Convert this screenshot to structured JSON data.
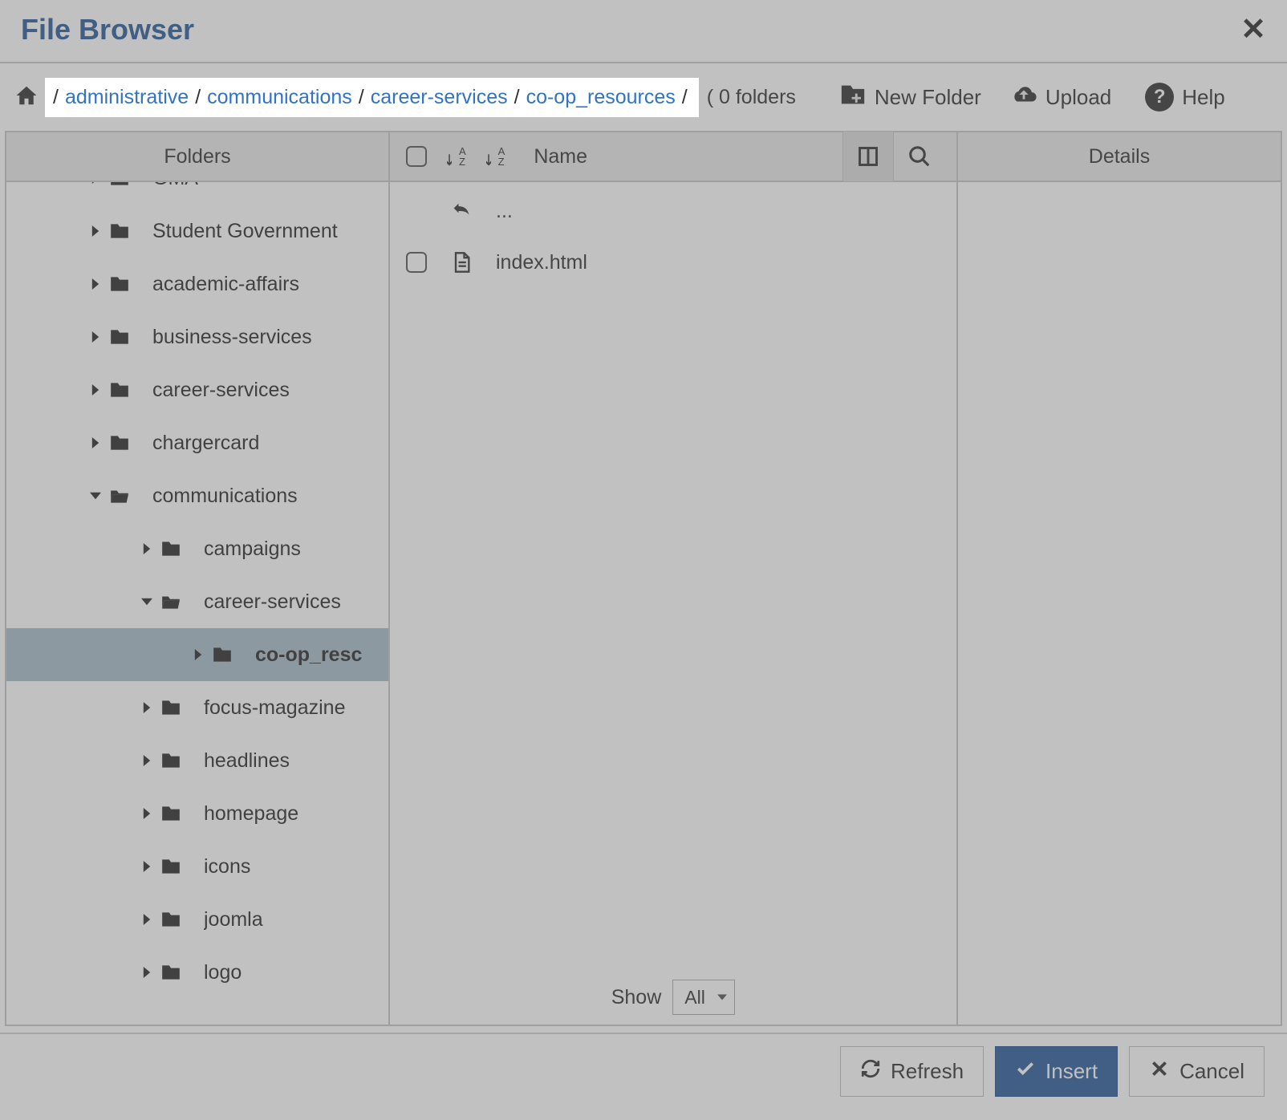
{
  "header": {
    "title": "File Browser"
  },
  "breadcrumb": {
    "items": [
      "administrative",
      "communications",
      "career-services",
      "co-op_resources"
    ],
    "folder_count_text": "( 0 folders"
  },
  "toolbar": {
    "new_folder": "New Folder",
    "upload": "Upload",
    "help": "Help"
  },
  "panes": {
    "folders_label": "Folders",
    "details_label": "Details",
    "name_label": "Name"
  },
  "tree": [
    {
      "label": "GMA",
      "level": 1,
      "expanded": false,
      "truncated": true
    },
    {
      "label": "Student Government",
      "level": 1,
      "expanded": false
    },
    {
      "label": "academic-affairs",
      "level": 1,
      "expanded": false
    },
    {
      "label": "business-services",
      "level": 1,
      "expanded": false
    },
    {
      "label": "career-services",
      "level": 1,
      "expanded": false
    },
    {
      "label": "chargercard",
      "level": 1,
      "expanded": false
    },
    {
      "label": "communications",
      "level": 1,
      "expanded": true,
      "open": true
    },
    {
      "label": "campaigns",
      "level": 2,
      "expanded": false
    },
    {
      "label": "career-services",
      "level": 2,
      "expanded": true,
      "open": true
    },
    {
      "label": "co-op_resources",
      "level": 3,
      "expanded": false,
      "selected": true,
      "display": "co-op_resc"
    },
    {
      "label": "focus-magazine",
      "level": 2,
      "expanded": false
    },
    {
      "label": "headlines",
      "level": 2,
      "expanded": false
    },
    {
      "label": "homepage",
      "level": 2,
      "expanded": false
    },
    {
      "label": "icons",
      "level": 2,
      "expanded": false
    },
    {
      "label": "joomla",
      "level": 2,
      "expanded": false
    },
    {
      "label": "logo",
      "level": 2,
      "expanded": false
    }
  ],
  "files": {
    "up_label": "...",
    "items": [
      {
        "name": "index.html",
        "type": "file"
      }
    ]
  },
  "show": {
    "label": "Show",
    "value": "All"
  },
  "footer": {
    "refresh": "Refresh",
    "insert": "Insert",
    "cancel": "Cancel"
  }
}
